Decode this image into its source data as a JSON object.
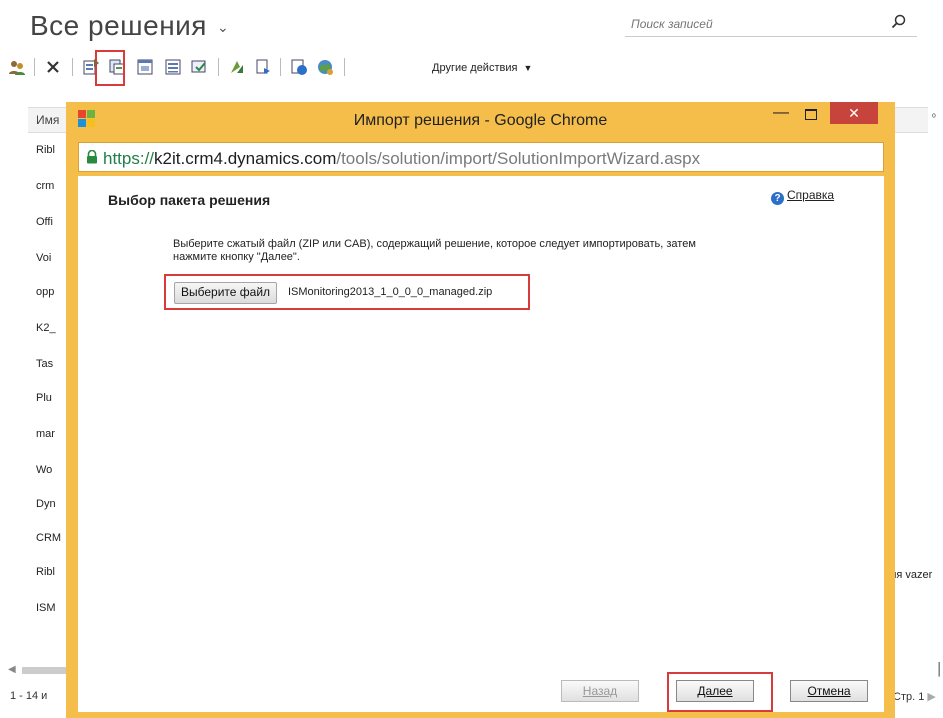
{
  "page": {
    "title": "Все решения",
    "search_placeholder": "Поиск записей",
    "more_actions": "Другие действия",
    "grid_header": "Имя",
    "rows": [
      "Ribl",
      "crm",
      "Offi",
      "Voi",
      "opp",
      "K2_",
      "Tas",
      "Plu",
      "mar",
      "Wo",
      "Dyn",
      "CRM",
      "Ribl",
      "ISM"
    ],
    "row_fragment_right": "ля vazer",
    "footer_count": "1 - 14 и",
    "footer_page": "Стр. 1"
  },
  "dialog": {
    "window_title": "Импорт решения - Google Chrome",
    "url_scheme": "https://",
    "url_host": "k2it.crm4.dynamics.com",
    "url_path": "/tools/solution/import/SolutionImportWizard.aspx",
    "heading": "Выбор пакета решения",
    "help_label": "Справка",
    "description": "Выберите сжатый файл (ZIP или CAB), содержащий решение, которое следует импортировать, затем нажмите кнопку \"Далее\".",
    "choose_file_label": "Выберите файл",
    "file_name": "ISMonitoring2013_1_0_0_0_managed.zip",
    "back_label": "Назад",
    "next_label": "Далее",
    "cancel_label": "Отмена"
  },
  "colors": {
    "dialog_frame": "#f5be4b",
    "close_button": "#c7443c",
    "highlight": "#d93a3a",
    "url_scheme": "#208048"
  }
}
